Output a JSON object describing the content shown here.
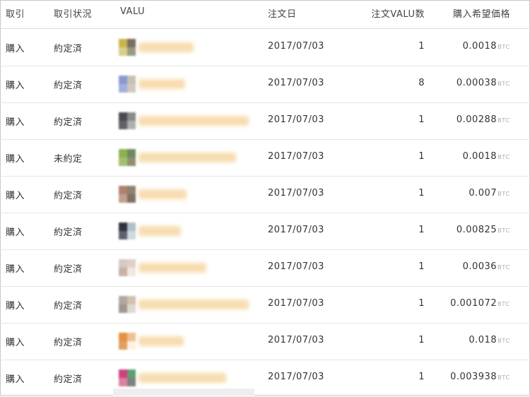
{
  "header": {
    "torihiki": "取引",
    "status": "取引状況",
    "valu": "VALU",
    "date": "注文日",
    "qty": "注文VALU数",
    "price": "購入希望価格"
  },
  "unit": "BTC",
  "rows": [
    {
      "type": "購入",
      "status": "約定済",
      "date": "2017/07/03",
      "qty": "1",
      "price": "0.0018"
    },
    {
      "type": "購入",
      "status": "約定済",
      "date": "2017/07/03",
      "qty": "8",
      "price": "0.00038"
    },
    {
      "type": "購入",
      "status": "約定済",
      "date": "2017/07/03",
      "qty": "1",
      "price": "0.00288"
    },
    {
      "type": "購入",
      "status": "未約定",
      "date": "2017/07/03",
      "qty": "1",
      "price": "0.0018"
    },
    {
      "type": "購入",
      "status": "約定済",
      "date": "2017/07/03",
      "qty": "1",
      "price": "0.007"
    },
    {
      "type": "購入",
      "status": "約定済",
      "date": "2017/07/03",
      "qty": "1",
      "price": "0.00825"
    },
    {
      "type": "購入",
      "status": "約定済",
      "date": "2017/07/03",
      "qty": "1",
      "price": "0.0036"
    },
    {
      "type": "購入",
      "status": "約定済",
      "date": "2017/07/03",
      "qty": "1",
      "price": "0.001072"
    },
    {
      "type": "購入",
      "status": "約定済",
      "date": "2017/07/03",
      "qty": "1",
      "price": "0.018"
    },
    {
      "type": "購入",
      "status": "約定済",
      "date": "2017/07/03",
      "qty": "1",
      "price": "0.003938"
    }
  ],
  "colors": {
    "avatars": [
      [
        "#c9b64a",
        "#7a7060",
        "#d7d08a",
        "#9a9a80"
      ],
      [
        "#8a9ad0",
        "#c8c0b0",
        "#a0b0e0",
        "#d0c8c0"
      ],
      [
        "#4a4a50",
        "#8a8a8a",
        "#606068",
        "#b0b0b0"
      ],
      [
        "#8fb050",
        "#708860",
        "#a0c070",
        "#909070"
      ],
      [
        "#b08070",
        "#908070",
        "#c0a090",
        "#807060"
      ],
      [
        "#303040",
        "#b0c0c8",
        "#606070",
        "#d0d8e0"
      ],
      [
        "#d8c8c0",
        "#e0d0c8",
        "#c8b0a8",
        "#f0e8e0"
      ],
      [
        "#b0a8a0",
        "#d0c0b0",
        "#a09890",
        "#e0d8d0"
      ],
      [
        "#e89040",
        "#f0c090",
        "#e0a060",
        "#fff0e0"
      ],
      [
        "#d04080",
        "#60a070",
        "#e080a0",
        "#808080"
      ]
    ],
    "name_blur": "#f6d9a8"
  }
}
